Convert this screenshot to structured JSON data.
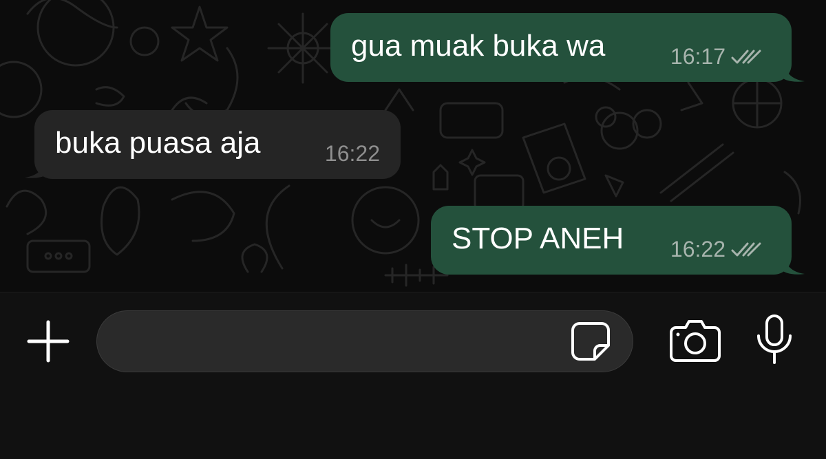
{
  "messages": [
    {
      "direction": "outgoing",
      "text": "gua muak buka wa",
      "time": "16:17",
      "status_icon": "double-check-icon"
    },
    {
      "direction": "incoming",
      "text": "buka puasa aja",
      "time": "16:22"
    },
    {
      "direction": "outgoing",
      "text": "STOP ANEH",
      "time": "16:22",
      "status_icon": "double-check-icon"
    }
  ],
  "composer": {
    "input_value": "",
    "input_placeholder": "",
    "icons": [
      "plus-icon",
      "sticker-icon",
      "camera-icon",
      "microphone-icon"
    ]
  },
  "colors": {
    "outgoing_bubble": "#24513c",
    "incoming_bubble": "#252525",
    "background": "#0c0c0c",
    "composer_bar": "#111111"
  }
}
